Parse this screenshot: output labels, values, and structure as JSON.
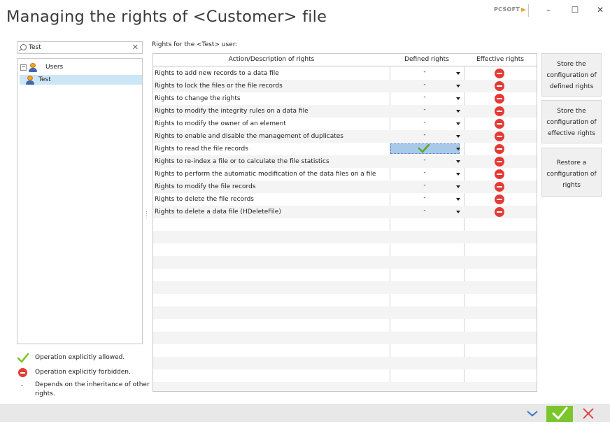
{
  "window": {
    "title": "Managing the rights of <Customer> file",
    "brand": "PCSOFT",
    "controls": {
      "minimize": "–",
      "maximize": "☐",
      "close": "✕"
    }
  },
  "search": {
    "value": "Test",
    "clear_glyph": "✕"
  },
  "tree": {
    "root_label": "Users",
    "expander_glyph": "−",
    "child_label": "Test",
    "icon": "user-icon"
  },
  "grid": {
    "caption": "Rights for the <Test> user:",
    "headers": [
      "Action/Description of rights",
      "Defined rights",
      "Effective rights"
    ],
    "rows": [
      {
        "action": "Rights to add new records to a data file",
        "defined": "-",
        "effective": "forbidden"
      },
      {
        "action": "Rights to lock the files or the file records",
        "defined": "-",
        "effective": "forbidden"
      },
      {
        "action": "Rights to change the rights",
        "defined": "-",
        "effective": "forbidden"
      },
      {
        "action": "Rights to modify the integrity rules on a data file",
        "defined": "-",
        "effective": "forbidden"
      },
      {
        "action": "Rights to modify the owner of an element",
        "defined": "-",
        "effective": "forbidden"
      },
      {
        "action": "Rights to enable and disable the management of duplicates",
        "defined": "-",
        "effective": "forbidden"
      },
      {
        "action": "Rights to read the file records",
        "defined": "allowed",
        "effective": "forbidden",
        "selected": true
      },
      {
        "action": "Rights to re-index a file or to calculate the file statistics",
        "defined": "-",
        "effective": "forbidden"
      },
      {
        "action": "Rights to perform the automatic modification of the data files on a file",
        "defined": "-",
        "effective": "forbidden"
      },
      {
        "action": "Rights to modify the file records",
        "defined": "-",
        "effective": "forbidden"
      },
      {
        "action": "Rights to delete the file records",
        "defined": "-",
        "effective": "forbidden"
      },
      {
        "action": "Rights to delete a data file (HDeleteFile)",
        "defined": "-",
        "effective": "forbidden"
      }
    ]
  },
  "side_buttons": [
    {
      "lines": [
        "Store the",
        "configuration of",
        "defined rights"
      ]
    },
    {
      "lines": [
        "Store the",
        "configuration of",
        "effective rights"
      ]
    },
    {
      "lines": [
        "Restore a",
        "configuration of",
        "rights"
      ]
    }
  ],
  "legend": {
    "allowed": "Operation explicitly allowed.",
    "forbidden": "Operation explicitly forbidden.",
    "inherit_line1": "Depends on the inheritance of other",
    "inherit_line2": "rights.",
    "inherit_symbol": "-"
  },
  "colors": {
    "accent_green": "#7ac62c",
    "forbidden_red": "#e33a36",
    "selection": "#a9c9ea",
    "nav_blue": "#3c78c8"
  }
}
